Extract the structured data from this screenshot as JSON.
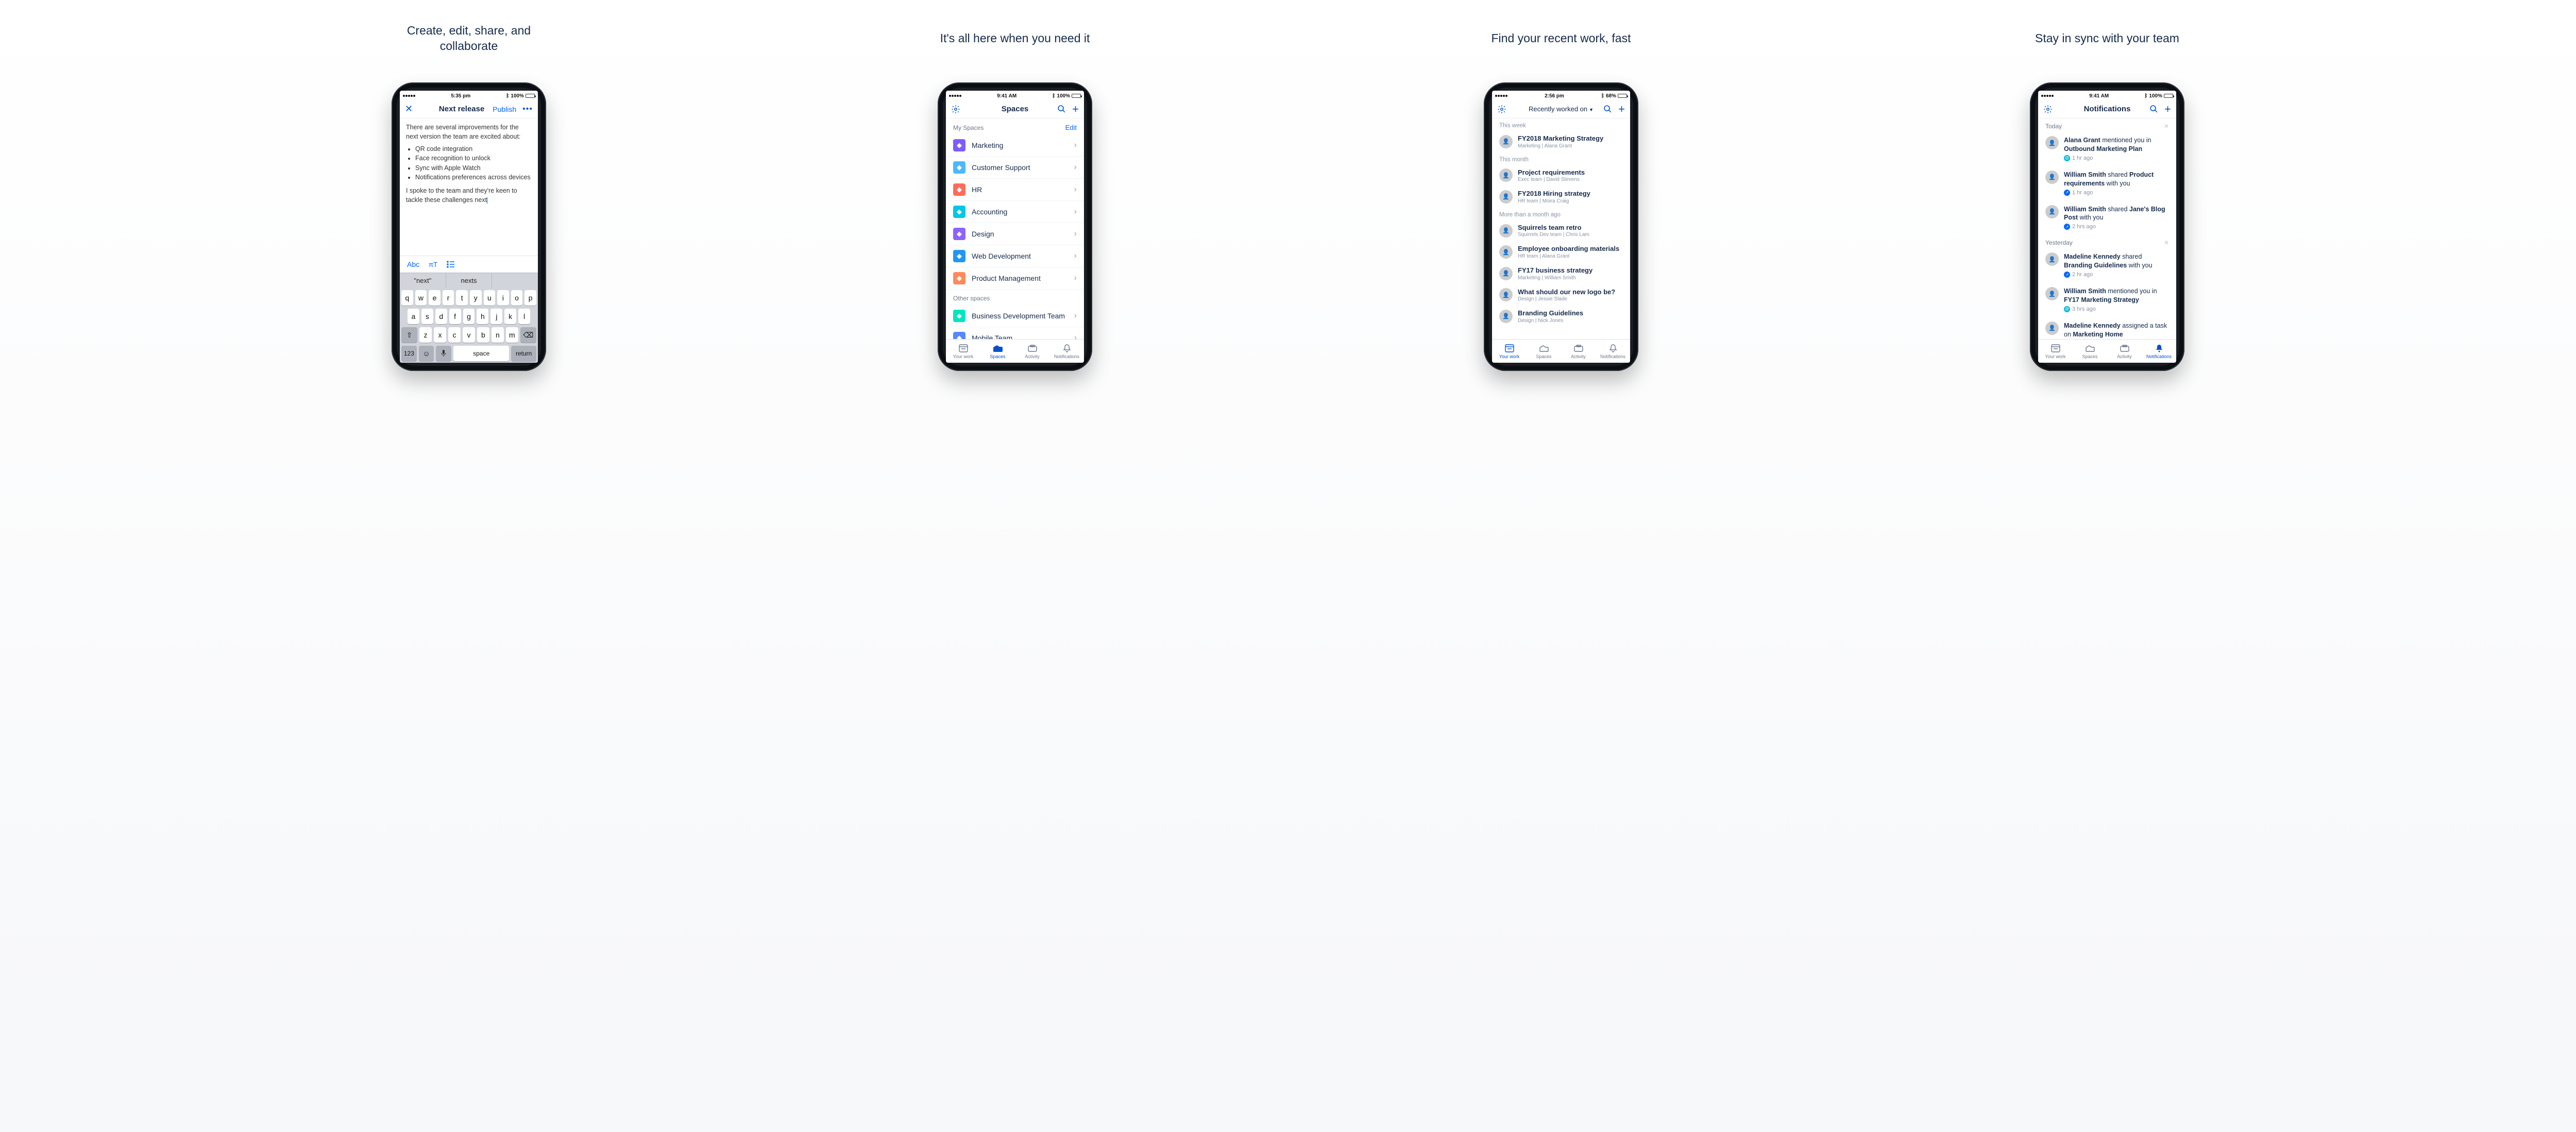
{
  "headlines": {
    "p1": "Create, edit, share, and collaborate",
    "p2": "It's all here when you need it",
    "p3": "Find your recent work, fast",
    "p4": "Stay in sync with your team"
  },
  "status": {
    "time1": "5:35 pm",
    "time2": "9:41 AM",
    "time3": "2:56 pm",
    "time4": "9:41 AM",
    "batt1": "100%",
    "batt2": "100%",
    "batt3": "68%",
    "batt4": "100%"
  },
  "editor": {
    "title": "Next release",
    "publish": "Publish",
    "intro": "There are several improvements for the next version the team are excited about:",
    "bullets": [
      "QR code integration",
      "Face recognition to unlock",
      "Sync with Apple Watch",
      "Notifications preferences across devices"
    ],
    "outro": "I spoke to the team and they're keen to tackle these challenges next",
    "abc": "Abc",
    "sugg1": "\"next\"",
    "sugg2": "nexts",
    "key_123": "123",
    "key_space": "space",
    "key_return": "return"
  },
  "spaces": {
    "title": "Spaces",
    "my_header": "My Spaces",
    "edit": "Edit",
    "items": [
      {
        "label": "Marketing",
        "color": "#7f5cff"
      },
      {
        "label": "Customer Support",
        "color": "#4db8ff"
      },
      {
        "label": "HR",
        "color": "#ff6c5c"
      },
      {
        "label": "Accounting",
        "color": "#00c7e6"
      },
      {
        "label": "Design",
        "color": "#8c63ff"
      },
      {
        "label": "Web Development",
        "color": "#2196f3"
      },
      {
        "label": "Product Management",
        "color": "#ff8a5b"
      }
    ],
    "other_header": "Other spaces",
    "other": [
      {
        "label": "Business Development Team",
        "color": "#00e6c2"
      },
      {
        "label": "Mobile Team",
        "color": "#5a86ff"
      }
    ]
  },
  "work": {
    "title": "Recently worked on",
    "sections": [
      {
        "header": "This week",
        "items": [
          {
            "title": "FY2018 Marketing Strategy",
            "sub": "Marketing | Alana Grant"
          }
        ]
      },
      {
        "header": "This month",
        "items": [
          {
            "title": "Project requirements",
            "sub": "Exec team | David Stevens"
          },
          {
            "title": "FY2018 Hiring strategy",
            "sub": "HR team | Moira Craig"
          }
        ]
      },
      {
        "header": "More than a month ago",
        "items": [
          {
            "title": "Squirrels team retro",
            "sub": "Squirrels Dev team | Chris Lam"
          },
          {
            "title": "Employee onboarding materials",
            "sub": "HR team | Alana Grant"
          },
          {
            "title": "FY17 business strategy",
            "sub": "Marketing | William Smith"
          },
          {
            "title": "What should our new logo be?",
            "sub": "Design | Jessie Slade"
          },
          {
            "title": "Branding Guidelines",
            "sub": "Design | Nick Jones"
          }
        ]
      }
    ]
  },
  "notif": {
    "title": "Notifications",
    "sections": [
      {
        "header": "Today",
        "items": [
          {
            "who": "Alana Grant",
            "verb": "mentioned you in",
            "what": "Outbound Marketing Plan",
            "time": "1 hr ago",
            "badge": "teal"
          },
          {
            "who": "William Smith",
            "verb": "shared",
            "what": "Product requirements",
            "suffix": "with you",
            "time": "1 hr ago",
            "badge": "blue"
          },
          {
            "who": "William Smith",
            "verb": "shared",
            "what": "Jane's Blog Post",
            "suffix": "with you",
            "time": "2 hrs ago",
            "badge": "blue"
          }
        ]
      },
      {
        "header": "Yesterday",
        "items": [
          {
            "who": "Madeline Kennedy",
            "verb": "shared",
            "what": "Branding Guidelines",
            "suffix": "with you",
            "time": "2 hr ago",
            "badge": "blue"
          },
          {
            "who": "William Smith",
            "verb": "mentioned you in",
            "what": "FY17 Marketing Strategy",
            "time": "3 hrs ago",
            "badge": "teal"
          },
          {
            "who": "Madeline Kennedy",
            "verb": "assigned a task on",
            "what": "Marketing Home",
            "time": "",
            "badge": "teal"
          }
        ]
      }
    ]
  },
  "tabs": {
    "your_work": "Your work",
    "spaces": "Spaces",
    "activity": "Activity",
    "notifications": "Notifications"
  }
}
